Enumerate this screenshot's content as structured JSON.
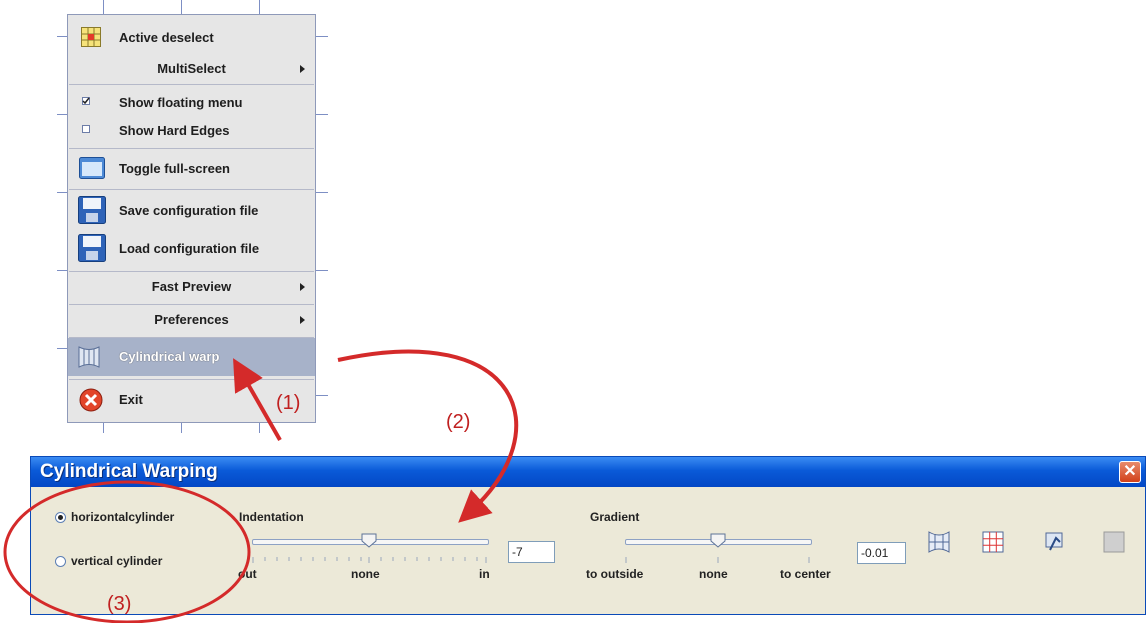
{
  "menu": {
    "items": [
      {
        "label": "Active deselect",
        "icon": "grid-select-icon"
      },
      {
        "label": "MultiSelect",
        "submenu": true
      },
      {
        "label": "Show floating menu",
        "checkbox": true,
        "checked": true
      },
      {
        "label": "Show Hard Edges",
        "checkbox": true,
        "checked": false
      },
      {
        "label": "Toggle full-screen",
        "icon": "window-icon"
      },
      {
        "label": "Save configuration file",
        "icon": "floppy-disk-icon"
      },
      {
        "label": "Load configuration file",
        "icon": "floppy-disk-icon"
      },
      {
        "label": "Fast Preview",
        "submenu": true
      },
      {
        "label": "Preferences",
        "submenu": true
      },
      {
        "label": "Cylindrical warp",
        "icon": "cylinder-warp-icon",
        "highlighted": true
      },
      {
        "label": "Exit",
        "icon": "exit-icon"
      }
    ]
  },
  "dialog": {
    "title": "Cylindrical Warping",
    "close_label": "✕",
    "radios": [
      {
        "label": "horizontalcylinder",
        "selected": true
      },
      {
        "label": "vertical cylinder",
        "selected": false
      }
    ],
    "indentation": {
      "label": "Indentation",
      "value": "-7",
      "ticks": [
        "out",
        "none",
        "in"
      ]
    },
    "gradient": {
      "label": "Gradient",
      "value": "-0.01",
      "ticks": [
        "to outside",
        "none",
        "to center"
      ]
    },
    "tool_icons": [
      "cylinder-warp-icon",
      "grid-icon",
      "reset-icon",
      "blank-square-icon"
    ]
  },
  "annotations": {
    "step1": "(1)",
    "step2": "(2)",
    "step3": "(3)"
  },
  "colors": {
    "title_bar": "#0a5ad8",
    "annotation": "#d42a2a",
    "menu_highlight": "#a7b2c9"
  }
}
